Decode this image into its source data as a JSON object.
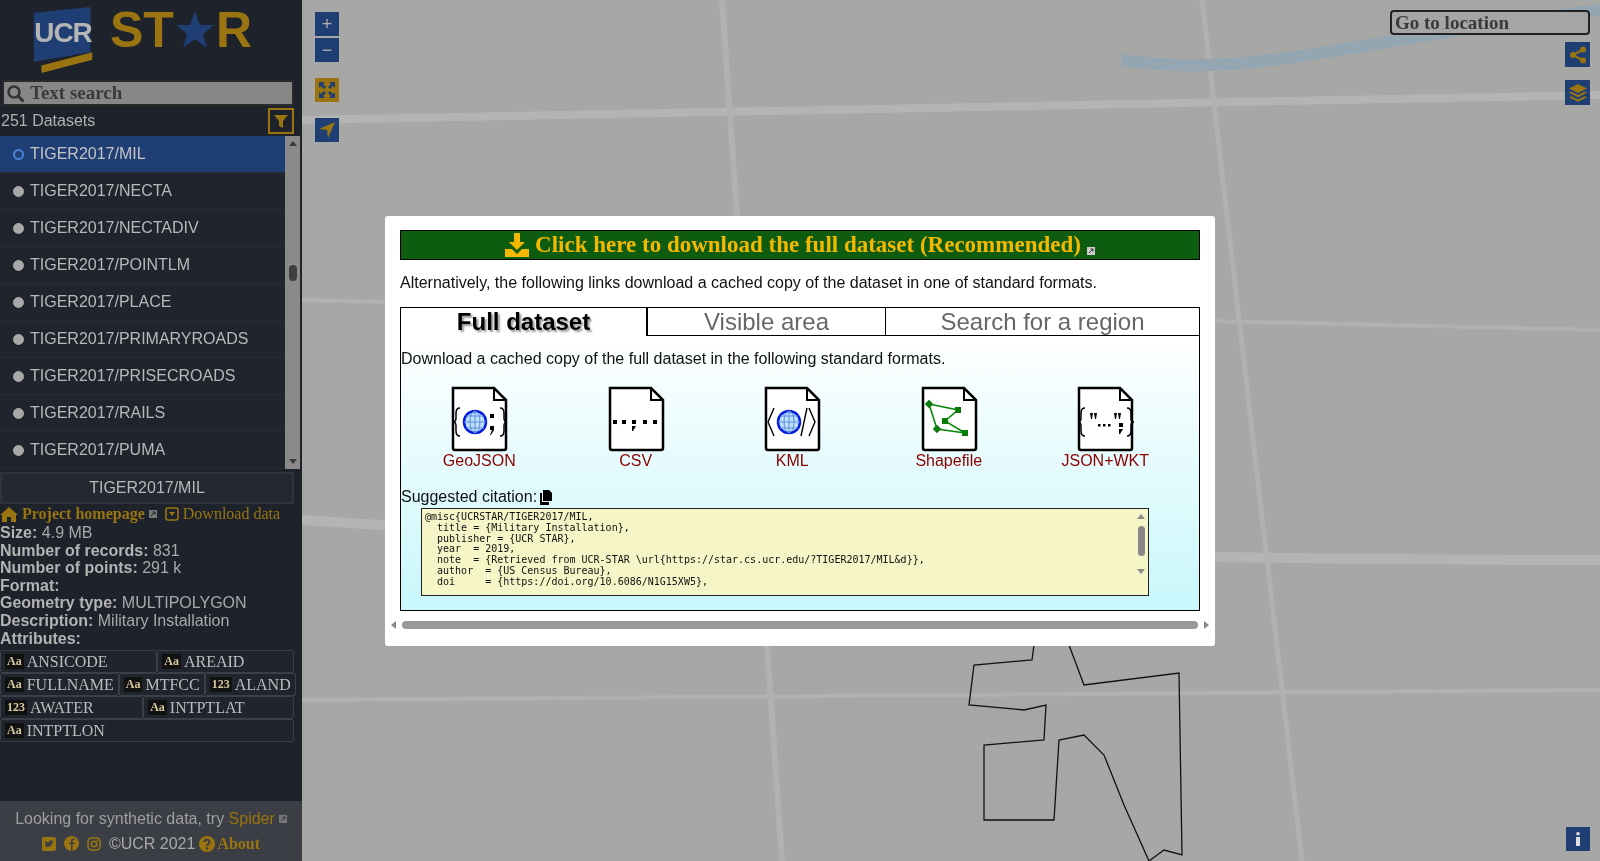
{
  "logo": {
    "badge": "UCR",
    "wordmark_left": "ST",
    "wordmark_right": "R"
  },
  "search": {
    "placeholder": "Text search"
  },
  "dataset_count": "251 Datasets",
  "datasets": [
    {
      "name": "TIGER2017/MIL",
      "selected": true
    },
    {
      "name": "TIGER2017/NECTA",
      "selected": false
    },
    {
      "name": "TIGER2017/NECTADIV",
      "selected": false
    },
    {
      "name": "TIGER2017/POINTLM",
      "selected": false
    },
    {
      "name": "TIGER2017/PLACE",
      "selected": false
    },
    {
      "name": "TIGER2017/PRIMARYROADS",
      "selected": false
    },
    {
      "name": "TIGER2017/PRISECROADS",
      "selected": false
    },
    {
      "name": "TIGER2017/RAILS",
      "selected": false
    },
    {
      "name": "TIGER2017/PUMA",
      "selected": false
    }
  ],
  "dataset_details": {
    "title": "TIGER2017/MIL",
    "homepage_link": "Project homepage",
    "download_link": "Download data",
    "fields": [
      {
        "label": "Size:",
        "value": "4.9 MB"
      },
      {
        "label": "Number of records:",
        "value": "831"
      },
      {
        "label": "Number of points:",
        "value": "291 k"
      },
      {
        "label": "Format:"
      },
      {
        "label": "Geometry type:",
        "value": "MULTIPOLYGON"
      },
      {
        "label": "Description:",
        "value": "Military Installation"
      },
      {
        "label": "Attributes:"
      }
    ],
    "attribute_rows": [
      [
        {
          "type": "Aa",
          "name": "ANSICODE"
        },
        {
          "type": "Aa",
          "name": "AREAID"
        }
      ],
      [
        {
          "type": "Aa",
          "name": "FULLNAME"
        },
        {
          "type": "Aa",
          "name": "MTFCC"
        },
        {
          "type": "123",
          "name": "ALAND"
        }
      ],
      [
        {
          "type": "123",
          "name": "AWATER"
        },
        {
          "type": "Aa",
          "name": "INTPTLAT"
        }
      ],
      [
        {
          "type": "Aa",
          "name": "INTPTLON"
        }
      ]
    ]
  },
  "footer": {
    "prompt": "Looking for synthetic data, try",
    "link": "Spider",
    "copyright": "©UCR 2021",
    "about": "About"
  },
  "map": {
    "kind": "picture",
    "zoom_in": "+",
    "zoom_out": "−",
    "location_placeholder": "Go to location"
  },
  "download_dialog": {
    "banner": "Click here to download the full dataset (Recommended)",
    "intro": "Alternatively, the following links download a cached copy of the dataset in one of standard formats.",
    "tabs": [
      {
        "label": "Full dataset",
        "selected": true
      },
      {
        "label": "Visible area",
        "selected": false
      },
      {
        "label": "Search for a region",
        "selected": false
      }
    ],
    "panel_text": "Download a cached copy of the full dataset in the following standard formats.",
    "formats": [
      {
        "label": "GeoJSON",
        "kind": "geojson"
      },
      {
        "label": "CSV",
        "kind": "csv"
      },
      {
        "label": "KML",
        "kind": "kml"
      },
      {
        "label": "Shapefile",
        "kind": "shapefile"
      },
      {
        "label": "JSON+WKT",
        "kind": "jsonwkt"
      }
    ],
    "citation_label": "Suggested citation:",
    "citation_lines": [
      "@misc{UCRSTAR/TIGER2017/MIL,",
      "  title = {Military Installation},",
      "  publisher = {UCR STAR},",
      "  year  = 2019,",
      "  note  = {Retrieved from UCR-STAR \\url{https://star.cs.ucr.edu/?TIGER2017/MIL&d}},",
      "  author  = {US Census Bureau},",
      "  doi     = {https://doi.org/10.6086/N1G15XW5},"
    ]
  }
}
